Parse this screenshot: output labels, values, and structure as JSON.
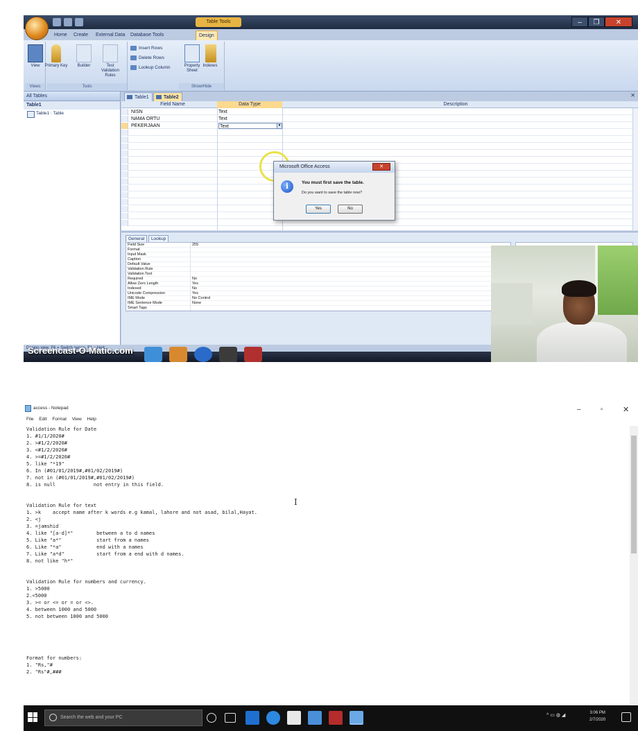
{
  "access": {
    "ribbon_tabs": [
      "Home",
      "Create",
      "External Data",
      "Database Tools",
      "Design"
    ],
    "contextual_tab": "Table Tools",
    "groups": {
      "views": "Views",
      "tools": "Tools",
      "show_hide": "Show/Hide"
    },
    "buttons": {
      "view": "View",
      "primary_key": "Primary Key",
      "builder": "Builder",
      "test_validation": "Test Validation Rules",
      "insert_rows": "Insert Rows",
      "delete_rows": "Delete Rows",
      "lookup_column": "Lookup Column",
      "property_sheet": "Property Sheet",
      "indexes": "Indexes"
    },
    "nav": {
      "header": "All Tables",
      "group": "Table1",
      "item": "Table1 : Table"
    },
    "doc_tabs": [
      "Table1",
      "Table2"
    ],
    "grid": {
      "headers": [
        "Field Name",
        "Data Type",
        "Description"
      ],
      "rows": [
        {
          "name": "NISN",
          "type": "Text"
        },
        {
          "name": "NAMA ORTU",
          "type": "Text"
        },
        {
          "name": "PEKERJAAN",
          "type": "Text"
        }
      ]
    },
    "property_tabs": [
      "General",
      "Lookup"
    ],
    "properties": [
      {
        "k": "Field Size",
        "v": "255"
      },
      {
        "k": "Format",
        "v": ""
      },
      {
        "k": "Input Mask",
        "v": ""
      },
      {
        "k": "Caption",
        "v": ""
      },
      {
        "k": "Default Value",
        "v": ""
      },
      {
        "k": "Validation Rule",
        "v": ""
      },
      {
        "k": "Validation Text",
        "v": ""
      },
      {
        "k": "Required",
        "v": "No"
      },
      {
        "k": "Allow Zero Length",
        "v": "Yes"
      },
      {
        "k": "Indexed",
        "v": "No"
      },
      {
        "k": "Unicode Compression",
        "v": "Yes"
      },
      {
        "k": "IME Mode",
        "v": "No Control"
      },
      {
        "k": "IME Sentence Mode",
        "v": "None"
      },
      {
        "k": "Smart Tags",
        "v": ""
      }
    ],
    "status": "Design view.  F6 = Switch panes.  F1 = Help.",
    "watermark": "Screencast-O-Matic.com",
    "dialog": {
      "title": "Microsoft Office Access",
      "message": "You must first save the table.",
      "question": "Do you want to save the table now?",
      "yes": "Yes",
      "no": "No"
    }
  },
  "notepad": {
    "title": "access - Notepad",
    "menu": [
      "File",
      "Edit",
      "Format",
      "View",
      "Help"
    ],
    "lines": [
      "Validation Rule for Date",
      "1. #1/1/2020#",
      "2. >#1/2/2020#",
      "3. <#1/2/2020#",
      "4. >=#1/2/2020#",
      "5. like \"*19\"",
      "6. In (#01/01/2019#,#01/02/2019#)",
      "7. not in (#01/01/2019#,#01/02/2019#)",
      "8. is null             not entry in this field.",
      "",
      "",
      "Validation Rule for text",
      "1. >k    accept name after k words e.g kamal, lahore and not asad, bilal,Hayat.",
      "2. <j",
      "3. =jamshid",
      "4. like \"[a-d]*\"        between a to d names",
      "5. Like \"a*\"            start from a names",
      "6. Like \"*a\"            end with a names",
      "7. Like \"a*d\"           start from a end with d names.",
      "8. not like \"h*\"",
      "",
      "",
      "Validation Rule for numbers and currency.",
      "1. >5000",
      "2.<5000",
      "3. >= or <= or = or <>.",
      "4. between 1000 and 5000",
      "5. not between 1000 and 5000",
      "",
      "",
      "",
      "",
      "",
      "Format for numbers:",
      "1. \"Rs,\"#",
      "2. \"Rs\"#,###"
    ],
    "search_placeholder": "Search the web and your PC",
    "clock_time": "3:06 PM",
    "clock_date": "2/7/2020"
  }
}
